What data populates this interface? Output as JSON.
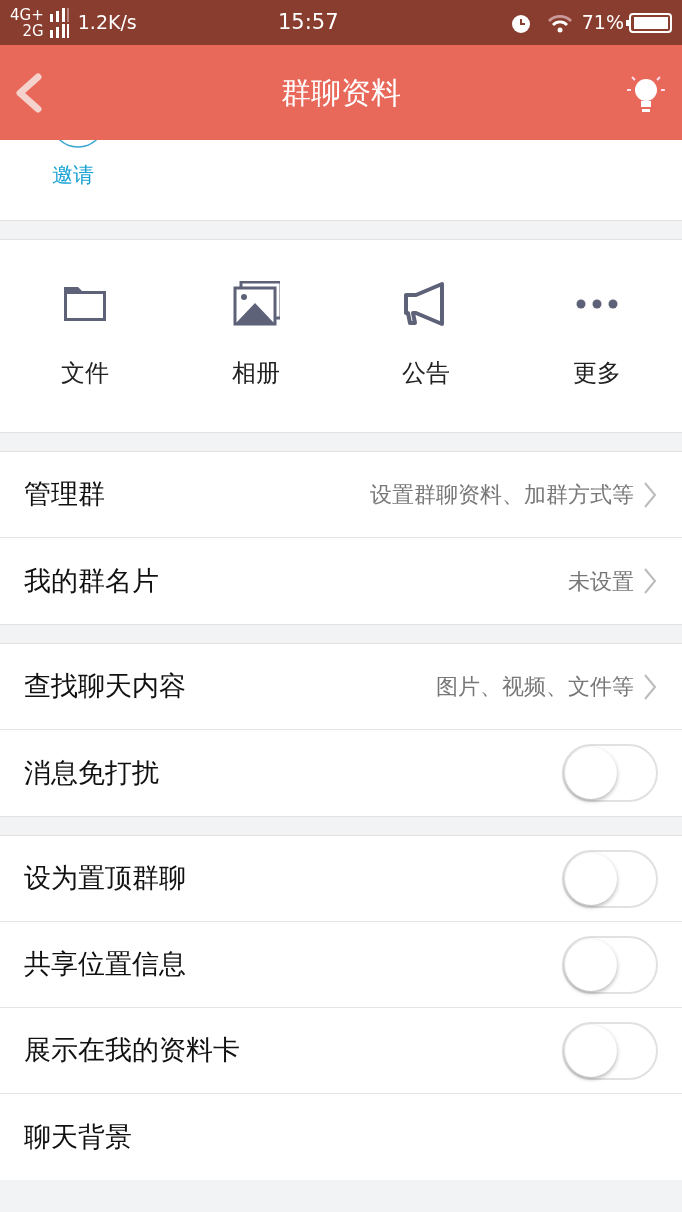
{
  "status_bar": {
    "network_top": "4G+",
    "network_bottom": "2G",
    "speed": "1.2K/s",
    "time": "15:57",
    "battery": "71%"
  },
  "header": {
    "title": "群聊资料"
  },
  "invite": {
    "label": "邀请"
  },
  "shortcuts": [
    {
      "label": "文件",
      "kind": "folder"
    },
    {
      "label": "相册",
      "kind": "album"
    },
    {
      "label": "公告",
      "kind": "announcement"
    },
    {
      "label": "更多",
      "kind": "more"
    }
  ],
  "sections": [
    {
      "rows": [
        {
          "kind": "link",
          "label": "管理群",
          "value": "设置群聊资料、加群方式等"
        },
        {
          "kind": "link",
          "label": "我的群名片",
          "value": "未设置"
        }
      ]
    },
    {
      "rows": [
        {
          "kind": "link",
          "label": "查找聊天内容",
          "value": "图片、视频、文件等"
        },
        {
          "kind": "toggle",
          "label": "消息免打扰",
          "on": false
        }
      ]
    },
    {
      "rows": [
        {
          "kind": "toggle",
          "label": "设为置顶群聊",
          "on": false
        },
        {
          "kind": "toggle",
          "label": "共享位置信息",
          "on": false
        },
        {
          "kind": "toggle",
          "label": "展示在我的资料卡",
          "on": false
        },
        {
          "kind": "plain",
          "label": "聊天背景"
        }
      ]
    }
  ]
}
